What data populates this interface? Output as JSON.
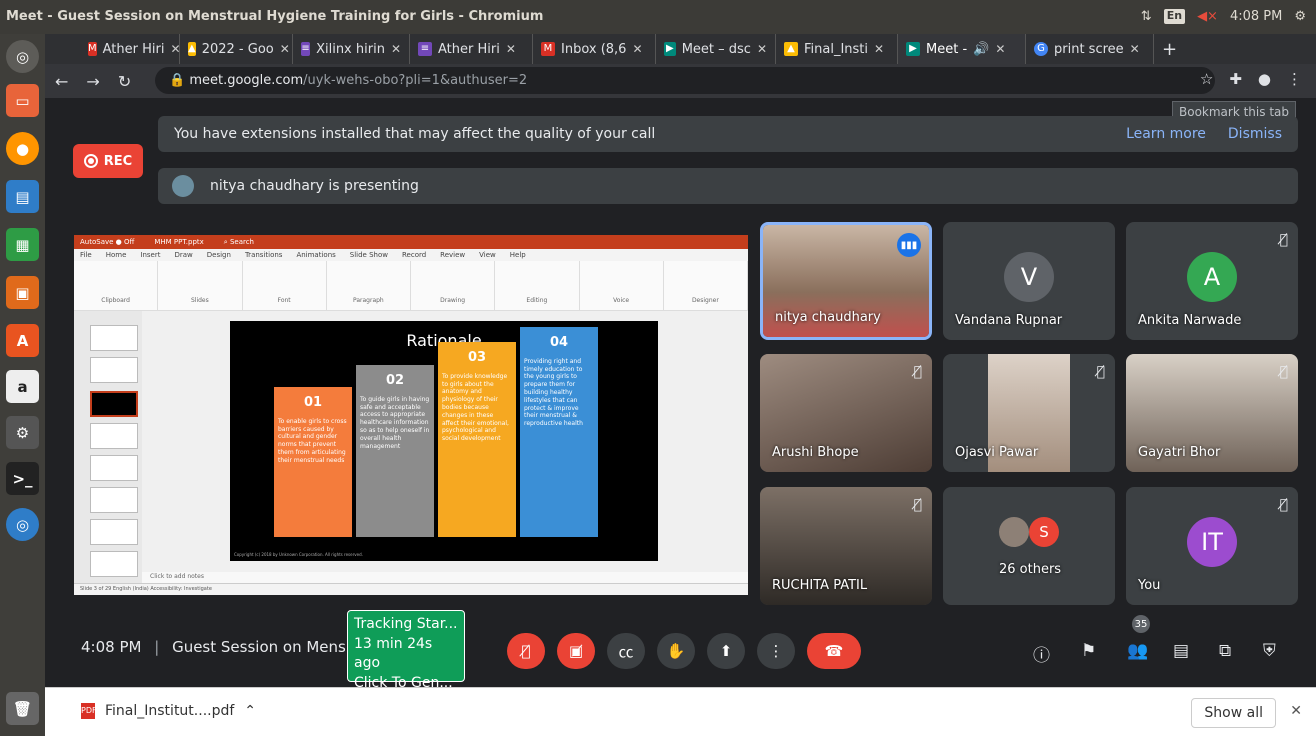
{
  "window": {
    "title": "Meet - Guest Session on Menstrual Hygiene Training for Girls - Chromium",
    "tray_kb": "En",
    "tray_time": "4:08 PM"
  },
  "browser": {
    "tabs": [
      {
        "label": "Ather Hiri",
        "favicon": "gmail-icon",
        "color": "#d93025"
      },
      {
        "label": "2022 - Goo",
        "favicon": "drive-icon",
        "color": "#fbbc04"
      },
      {
        "label": "Xilinx hirin",
        "favicon": "forms-icon",
        "color": "#7248b9"
      },
      {
        "label": "Ather Hiri",
        "favicon": "forms-icon",
        "color": "#7248b9"
      },
      {
        "label": "Inbox (8,6",
        "favicon": "gmail-icon",
        "color": "#d93025"
      },
      {
        "label": "Meet – dsc",
        "favicon": "meet-icon",
        "color": "#00897b"
      },
      {
        "label": "Final_Insti",
        "favicon": "drive-icon",
        "color": "#fbbc04"
      },
      {
        "label": "Meet -",
        "favicon": "meet-icon",
        "color": "#00897b"
      },
      {
        "label": "print scree",
        "favicon": "google-icon",
        "color": "#4285f4"
      }
    ],
    "url_host": "meet.google.com",
    "url_path": "/uyk-wehs-obo?pli=1&authuser=2",
    "bookmark_tooltip": "Bookmark this tab"
  },
  "notice": {
    "message": "You have extensions installed that may affect the quality of your call",
    "learn_more": "Learn more",
    "dismiss": "Dismiss"
  },
  "rec_label": "REC",
  "presenting_text": "nitya chaudhary is presenting",
  "slide": {
    "title": "Rationale",
    "copyright": "Copyright (c) 2018 by Unknown Corporation. All rights reserved.",
    "ribbons": [
      {
        "num": "01",
        "text": "To enable girls to cross barriers caused by cultural and gender norms that prevent them from articulating their menstrual needs",
        "color": "#f47c3c"
      },
      {
        "num": "02",
        "text": "To guide girls in having safe and acceptable access to appropriate healthcare information so as to help oneself in overall health management",
        "color": "#8c8c8c"
      },
      {
        "num": "03",
        "text": "To provide knowledge to girls about the anatomy and physiology of their bodies because changes in these affect their emotional, psychological and social development",
        "color": "#f6a821"
      },
      {
        "num": "04",
        "text": "Providing right and timely education to the young girls to prepare them for building healthy lifestyles that can protect & improve their menstrual & reproductive health",
        "color": "#3b8fd6"
      }
    ],
    "notes": "Click to add notes",
    "status": "Slide 3 of 29    English (India)    Accessibility: Investigate"
  },
  "participants": [
    {
      "name": "nitya chaudhary",
      "initial": "",
      "color": "#8a6f5c",
      "speaking": true
    },
    {
      "name": "Vandana Rupnar",
      "initial": "V",
      "color": "#5f6368",
      "speaking": false
    },
    {
      "name": "Ankita Narwade",
      "initial": "A",
      "color": "#34a853",
      "speaking": false
    },
    {
      "name": "Arushi Bhope",
      "initial": "",
      "color": "#6d5a52",
      "speaking": false
    },
    {
      "name": "Ojasvi Pawar",
      "initial": "",
      "color": "#b8a79a",
      "speaking": false
    },
    {
      "name": "Gayatri Bhor",
      "initial": "",
      "color": "#8d8076",
      "speaking": false
    },
    {
      "name": "RUCHITA PATIL",
      "initial": "",
      "color": "#4e4843",
      "speaking": false
    },
    {
      "name": "26 others",
      "initial": "S",
      "color": "#ea4335",
      "speaking": false
    },
    {
      "name": "You",
      "initial": "IT",
      "color": "#9c4ccf",
      "speaking": false
    }
  ],
  "bottom": {
    "time": "4:08 PM",
    "meeting_name": "Guest Session on Mens...",
    "tracking_lines": [
      "Tracking Star...",
      "13 min 24s ago",
      "Click To Gen..."
    ],
    "participant_count": "35"
  },
  "download": {
    "filename": "Final_Institut....pdf",
    "show_all": "Show all"
  }
}
